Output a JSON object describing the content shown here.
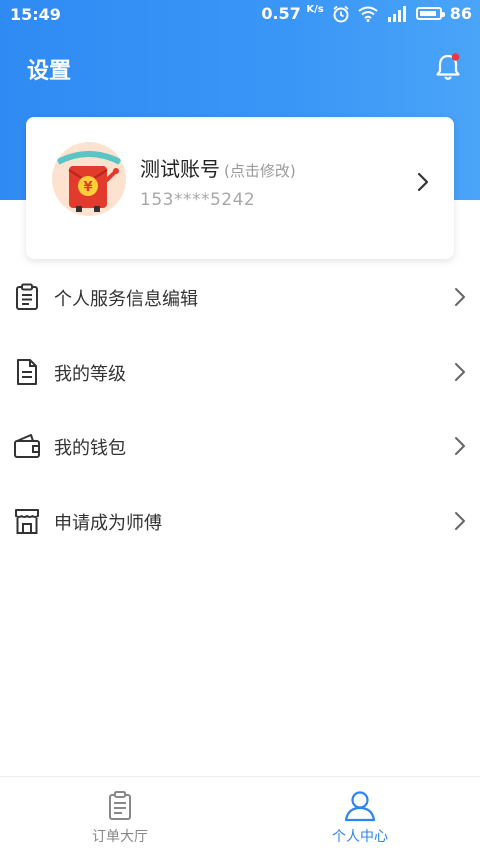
{
  "status_bar": {
    "time": "15:49",
    "speed_value": "0.57",
    "speed_unit": "K/s",
    "battery": "86"
  },
  "header": {
    "title": "设置"
  },
  "profile": {
    "name": "测试账号",
    "edit_hint": "(点击修改)",
    "phone": "153****5242"
  },
  "menu": {
    "items": [
      {
        "label": "个人服务信息编辑",
        "icon": "clipboard-icon"
      },
      {
        "label": "我的等级",
        "icon": "document-icon"
      },
      {
        "label": "我的钱包",
        "icon": "wallet-icon"
      },
      {
        "label": "申请成为师傅",
        "icon": "shop-icon"
      }
    ]
  },
  "bottom_nav": {
    "tabs": [
      {
        "label": "订单大厅",
        "icon": "order-list-icon",
        "active": false
      },
      {
        "label": "个人中心",
        "icon": "person-icon",
        "active": true
      }
    ]
  },
  "colors": {
    "primary": "#2f8bf3",
    "active_tab": "#2e84f0",
    "notification_dot": "#e8383d"
  }
}
